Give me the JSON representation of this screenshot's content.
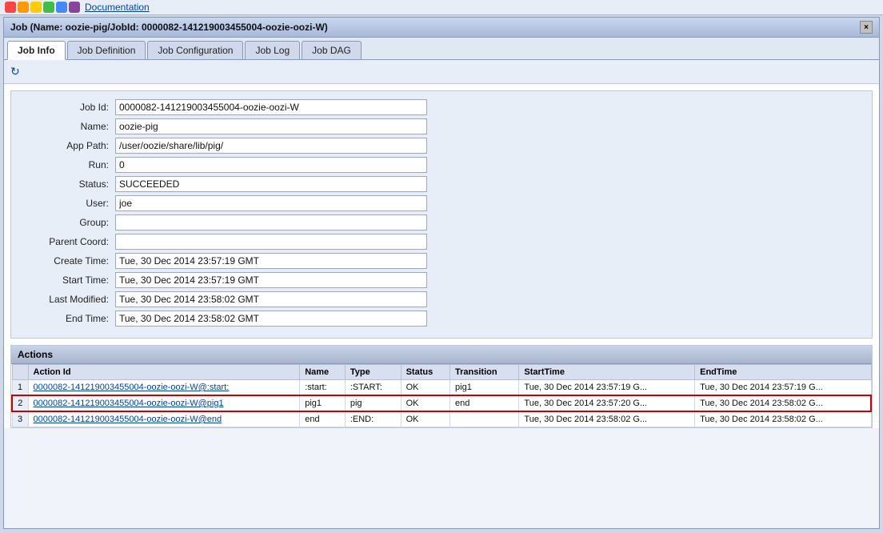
{
  "topbar": {
    "doc_link": "Documentation",
    "logo_colors": [
      "#ff4444",
      "#ff9900",
      "#ffcc00",
      "#44bb44",
      "#4488ff",
      "#884499"
    ]
  },
  "window": {
    "title": "Job (Name: oozie-pig/JobId: 0000082-141219003455004-oozie-oozi-W)",
    "close_label": "×"
  },
  "tabs": [
    {
      "label": "Job Info",
      "active": true
    },
    {
      "label": "Job Definition",
      "active": false
    },
    {
      "label": "Job Configuration",
      "active": false
    },
    {
      "label": "Job Log",
      "active": false
    },
    {
      "label": "Job DAG",
      "active": false
    }
  ],
  "form": {
    "fields": [
      {
        "label": "Job Id:",
        "value": "0000082-141219003455004-oozie-oozi-W"
      },
      {
        "label": "Name:",
        "value": "oozie-pig"
      },
      {
        "label": "App Path:",
        "value": "/user/oozie/share/lib/pig/"
      },
      {
        "label": "Run:",
        "value": "0"
      },
      {
        "label": "Status:",
        "value": "SUCCEEDED"
      },
      {
        "label": "User:",
        "value": "joe"
      },
      {
        "label": "Group:",
        "value": ""
      },
      {
        "label": "Parent Coord:",
        "value": ""
      },
      {
        "label": "Create Time:",
        "value": "Tue, 30 Dec 2014 23:57:19 GMT"
      },
      {
        "label": "Start Time:",
        "value": "Tue, 30 Dec 2014 23:57:19 GMT"
      },
      {
        "label": "Last Modified:",
        "value": "Tue, 30 Dec 2014 23:58:02 GMT"
      },
      {
        "label": "End Time:",
        "value": "Tue, 30 Dec 2014 23:58:02 GMT"
      }
    ]
  },
  "actions": {
    "section_label": "Actions",
    "columns": [
      "Action Id",
      "Name",
      "Type",
      "Status",
      "Transition",
      "StartTime",
      "EndTime"
    ],
    "rows": [
      {
        "num": "1",
        "action_id": "0000082-141219003455004-oozie-oozi-W@:start:",
        "name": ":start:",
        "type": ":START:",
        "status": "OK",
        "transition": "pig1",
        "start_time": "Tue, 30 Dec 2014 23:57:19 G...",
        "end_time": "Tue, 30 Dec 2014 23:57:19 G...",
        "selected": false
      },
      {
        "num": "2",
        "action_id": "0000082-141219003455004-oozie-oozi-W@pig1",
        "name": "pig1",
        "type": "pig",
        "status": "OK",
        "transition": "end",
        "start_time": "Tue, 30 Dec 2014 23:57:20 G...",
        "end_time": "Tue, 30 Dec 2014 23:58:02 G...",
        "selected": true
      },
      {
        "num": "3",
        "action_id": "0000082-141219003455004-oozie-oozi-W@end",
        "name": "end",
        "type": ":END:",
        "status": "OK",
        "transition": "",
        "start_time": "Tue, 30 Dec 2014 23:58:02 G...",
        "end_time": "Tue, 30 Dec 2014 23:58:02 G...",
        "selected": false
      }
    ]
  }
}
